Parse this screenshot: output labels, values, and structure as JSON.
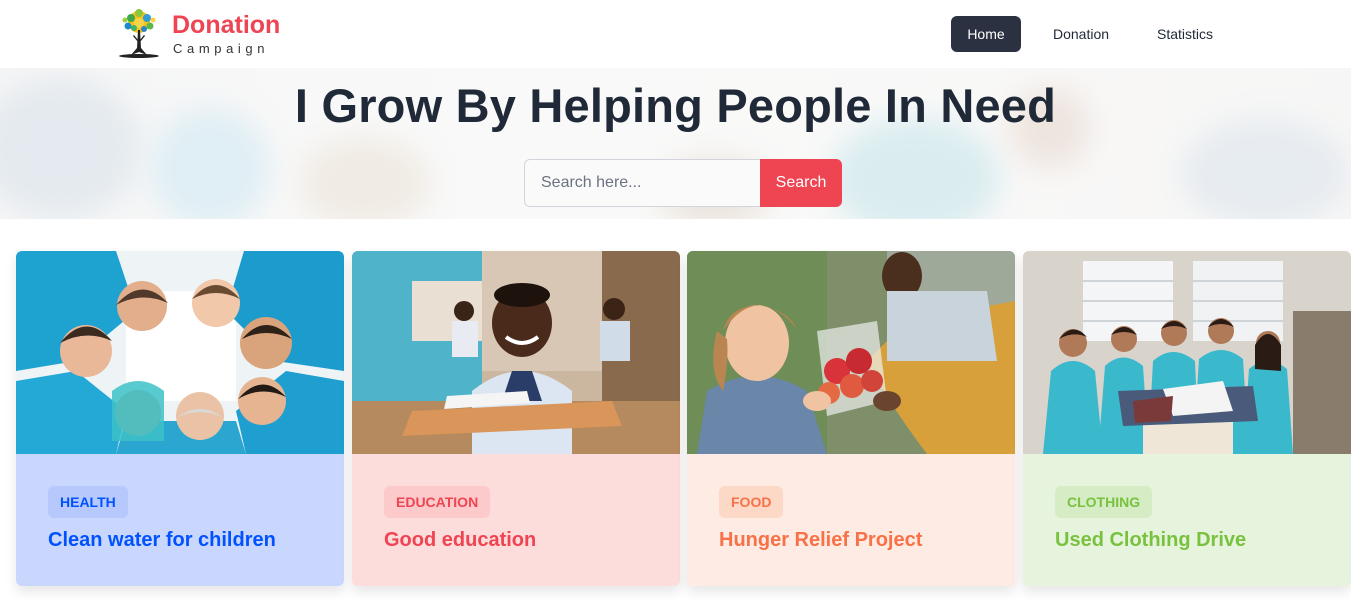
{
  "brand": {
    "title": "Donation",
    "subtitle": "Campaign",
    "logo_icon": "tree-icon",
    "color": "#ef4452"
  },
  "nav": {
    "items": [
      {
        "label": "Home",
        "active": true
      },
      {
        "label": "Donation",
        "active": false
      },
      {
        "label": "Statistics",
        "active": false
      }
    ]
  },
  "hero": {
    "title": "I Grow By Helping People In Need",
    "search_placeholder": "Search here...",
    "search_button": "Search",
    "button_color": "#ef4452"
  },
  "cards": [
    {
      "category": "Health",
      "title": "Clean water for children",
      "image": "volunteers-circle-photo",
      "card_bg": "#c9d7ff",
      "category_bg": "#b7c9fc",
      "text_color": "#0052ff"
    },
    {
      "category": "Education",
      "title": "Good education",
      "image": "student-classroom-photo",
      "card_bg": "#fddcdc",
      "category_bg": "#fccaca",
      "text_color": "#ef4452"
    },
    {
      "category": "Food",
      "title": "Hunger Relief Project",
      "image": "girl-receiving-food-photo",
      "card_bg": "#feebe3",
      "category_bg": "#fcd8c7",
      "text_color": "#f87147"
    },
    {
      "category": "Clothing",
      "title": "Used Clothing Drive",
      "image": "clothing-volunteers-photo",
      "card_bg": "#e7f4dd",
      "category_bg": "#d5ecc4",
      "text_color": "#79c23f"
    }
  ]
}
